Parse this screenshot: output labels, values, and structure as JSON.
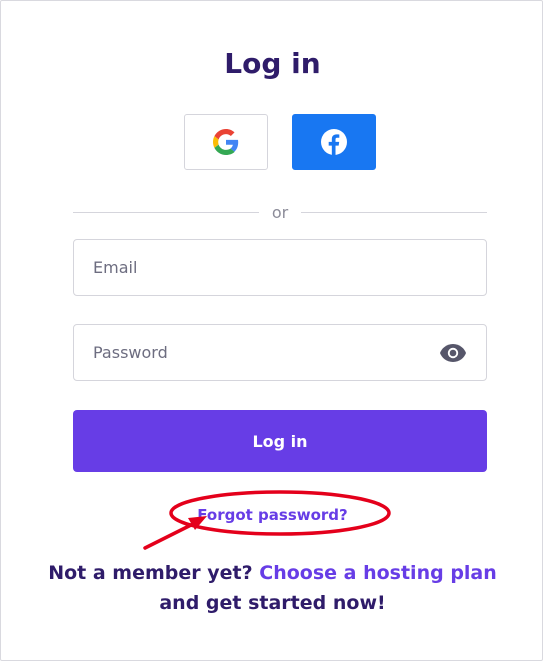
{
  "page": {
    "title": "Log in"
  },
  "social": {
    "google_icon": "google-g-icon",
    "facebook_icon": "facebook-f-icon"
  },
  "divider": {
    "text": "or"
  },
  "form": {
    "email_placeholder": "Email",
    "password_placeholder": "Password",
    "submit_label": "Log in"
  },
  "links": {
    "forgot_password": "Forgot password?"
  },
  "footer": {
    "prefix": "Not a member yet?",
    "link": "Choose a hosting plan",
    "suffix": "and get started now!"
  },
  "colors": {
    "accent": "#673de6",
    "heading": "#2f1c6a",
    "facebook": "#1877f2",
    "annotation": "#e4001b"
  }
}
